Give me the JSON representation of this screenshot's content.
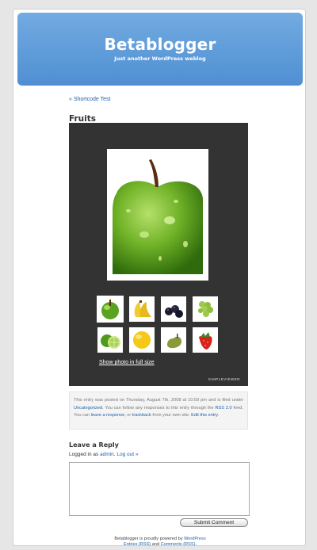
{
  "header": {
    "title": "Betablogger",
    "tagline": "Just another WordPress weblog"
  },
  "nav": {
    "prev_link": "« Shortcode Test"
  },
  "post": {
    "title": "Fruits",
    "gallery": {
      "main_image": "green-apple",
      "thumbnails": [
        {
          "name": "thumb-green-apple",
          "fruit": "green apple",
          "selected": true
        },
        {
          "name": "thumb-bananas",
          "fruit": "bananas"
        },
        {
          "name": "thumb-blackberries",
          "fruit": "blackberries"
        },
        {
          "name": "thumb-grapes",
          "fruit": "green grapes"
        },
        {
          "name": "thumb-limes",
          "fruit": "limes"
        },
        {
          "name": "thumb-lemon",
          "fruit": "lemon"
        },
        {
          "name": "thumb-pear",
          "fruit": "pear"
        },
        {
          "name": "thumb-strawberry",
          "fruit": "strawberry"
        }
      ],
      "show_full_size": "Show photo in full size",
      "badge": "SIMPLEVIEWER"
    },
    "meta": {
      "text_1": "This entry was posted on Thursday, August 7th, 2008 at 10:59 pm and is filed under ",
      "category": "Uncategorized",
      "text_2": ". You can follow any responses to this entry through the ",
      "rss": "RSS 2.0",
      "text_3": " feed. You can ",
      "leave_response": "leave a response",
      "text_4": ", or ",
      "trackback": "trackback",
      "text_5": " from your own site. ",
      "edit": "Edit this entry",
      "text_6": "."
    }
  },
  "reply": {
    "heading": "Leave a Reply",
    "logged_prefix": "Logged in as ",
    "user": "admin",
    "sep": ". ",
    "logout": "Log out »",
    "comment_value": "",
    "submit": "Submit Comment"
  },
  "footer": {
    "line1_prefix": "Betablogger is proudly powered by ",
    "wordpress": "WordPress",
    "entries_rss": "Entries (RSS)",
    "and": " and ",
    "comments_rss": "Comments (RSS)",
    "end": "."
  },
  "colors": {
    "header_top": "#73abe2",
    "header_bottom": "#4f8fd2",
    "link": "#2162a8",
    "viewer_bg": "#333333"
  }
}
